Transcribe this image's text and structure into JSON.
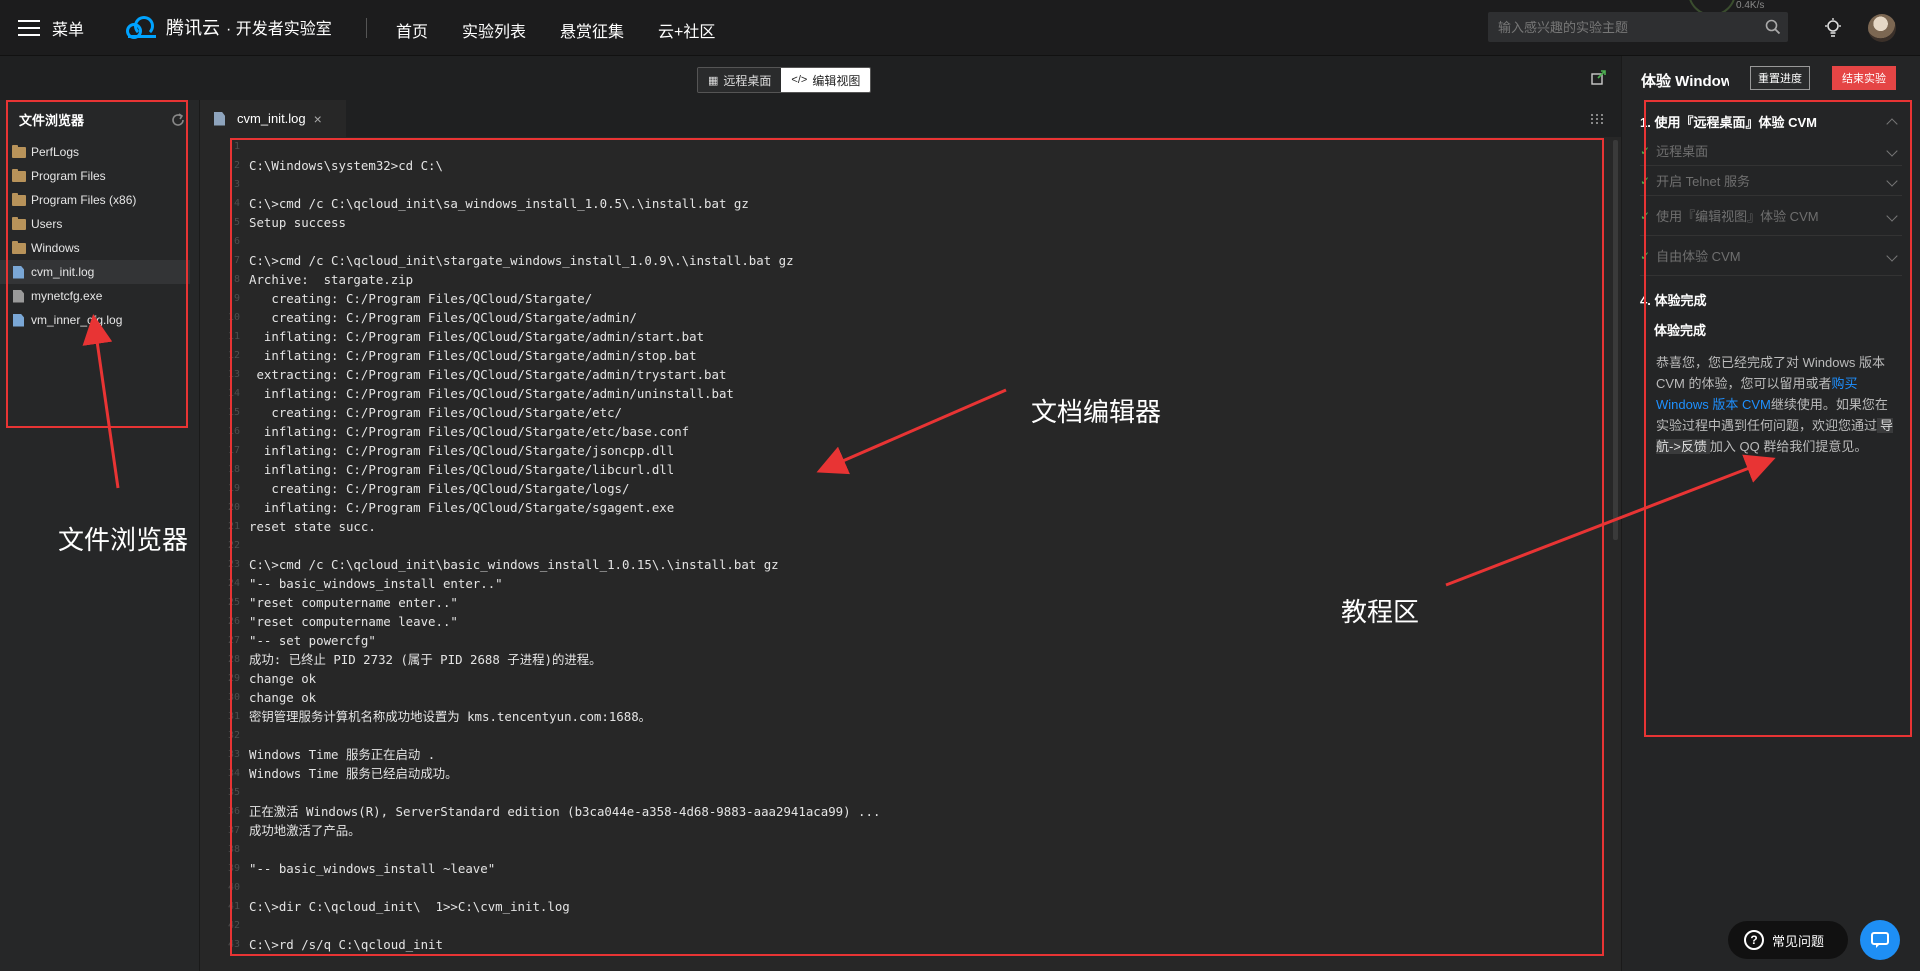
{
  "topnav": {
    "menu_label": "菜单",
    "brand": "腾讯云",
    "brand_sub": "· 开发者实验室",
    "links": [
      "首页",
      "实验列表",
      "悬赏征集",
      "云+社区"
    ],
    "search_placeholder": "输入感兴趣的实验主题",
    "speed_text": "0.4K/s"
  },
  "subbar": {
    "remote_desktop": "远程桌面",
    "edit_view": "编辑视图"
  },
  "file_browser": {
    "title": "文件浏览器",
    "items": [
      {
        "name": "PerfLogs",
        "type": "folder"
      },
      {
        "name": "Program Files",
        "type": "folder"
      },
      {
        "name": "Program Files (x86)",
        "type": "folder"
      },
      {
        "name": "Users",
        "type": "folder"
      },
      {
        "name": "Windows",
        "type": "folder"
      },
      {
        "name": "cvm_init.log",
        "type": "file"
      },
      {
        "name": "mynetcfg.exe",
        "type": "exe"
      },
      {
        "name": "vm_inner_cfg.log",
        "type": "file"
      }
    ]
  },
  "editor": {
    "tab": "cvm_init.log",
    "lines": [
      "",
      "C:\\Windows\\system32>cd C:\\",
      "",
      "C:\\>cmd /c C:\\qcloud_init\\sa_windows_install_1.0.5\\.\\install.bat gz",
      "Setup success",
      "",
      "C:\\>cmd /c C:\\qcloud_init\\stargate_windows_install_1.0.9\\.\\install.bat gz",
      "Archive:  stargate.zip",
      "   creating: C:/Program Files/QCloud/Stargate/",
      "   creating: C:/Program Files/QCloud/Stargate/admin/",
      "  inflating: C:/Program Files/QCloud/Stargate/admin/start.bat",
      "  inflating: C:/Program Files/QCloud/Stargate/admin/stop.bat",
      " extracting: C:/Program Files/QCloud/Stargate/admin/trystart.bat",
      "  inflating: C:/Program Files/QCloud/Stargate/admin/uninstall.bat",
      "   creating: C:/Program Files/QCloud/Stargate/etc/",
      "  inflating: C:/Program Files/QCloud/Stargate/etc/base.conf",
      "  inflating: C:/Program Files/QCloud/Stargate/jsoncpp.dll",
      "  inflating: C:/Program Files/QCloud/Stargate/libcurl.dll",
      "   creating: C:/Program Files/QCloud/Stargate/logs/",
      "  inflating: C:/Program Files/QCloud/Stargate/sgagent.exe",
      "reset state succ.",
      "",
      "C:\\>cmd /c C:\\qcloud_init\\basic_windows_install_1.0.15\\.\\install.bat gz",
      "\"-- basic_windows_install enter..\"",
      "\"reset computername enter..\"",
      "\"reset computername leave..\"",
      "\"-- set powercfg\"",
      "成功: 已终止 PID 2732 (属于 PID 2688 子进程)的进程。",
      "change ok",
      "change ok",
      "密钥管理服务计算机名称成功地设置为 kms.tencentyun.com:1688。",
      "",
      "Windows Time 服务正在启动 .",
      "Windows Time 服务已经启动成功。",
      "",
      "正在激活 Windows(R), ServerStandard edition (b3ca044e-a358-4d68-9883-aaa2941aca99) ...",
      "成功地激活了产品。",
      "",
      "\"-- basic_windows_install ~leave\"",
      "",
      "C:\\>dir C:\\qcloud_init\\  1>>C:\\cvm_init.log",
      "",
      "C:\\>rd /s/q C:\\qcloud_init"
    ]
  },
  "tutorial": {
    "title": "体验 Windows",
    "reset_label": "重置进度",
    "end_label": "结束实验",
    "step1": "1. 使用『远程桌面』体验 CVM",
    "sub_remote": "远程桌面",
    "sub_telnet": "开启 Telnet 服务",
    "step2": "使用『编辑视图』体验 CVM",
    "step3": "自由体验 CVM",
    "step4": "4. 体验完成",
    "done_title": "体验完成",
    "done_text_1": "恭喜您，您已经完成了对 Windows 版本 CVM 的体验，您可以留用或者",
    "done_link": "购买 Windows 版本 CVM",
    "done_text_2": "继续使用。如果您在实验过程中遇到任何问题，欢迎您通过",
    "done_nav": "导航->反馈",
    "done_text_3": "加入 QQ 群给我们提意见。"
  },
  "floating": {
    "faq": "常见问题"
  },
  "annotations": {
    "file_browser": "文件浏览器",
    "doc_editor": "文档编辑器",
    "tutorial": "教程区"
  },
  "colors": {
    "accent_red": "#e54545",
    "annotation_red": "#e83434",
    "link_blue": "#1e90ff",
    "check_green": "#4caf50"
  }
}
